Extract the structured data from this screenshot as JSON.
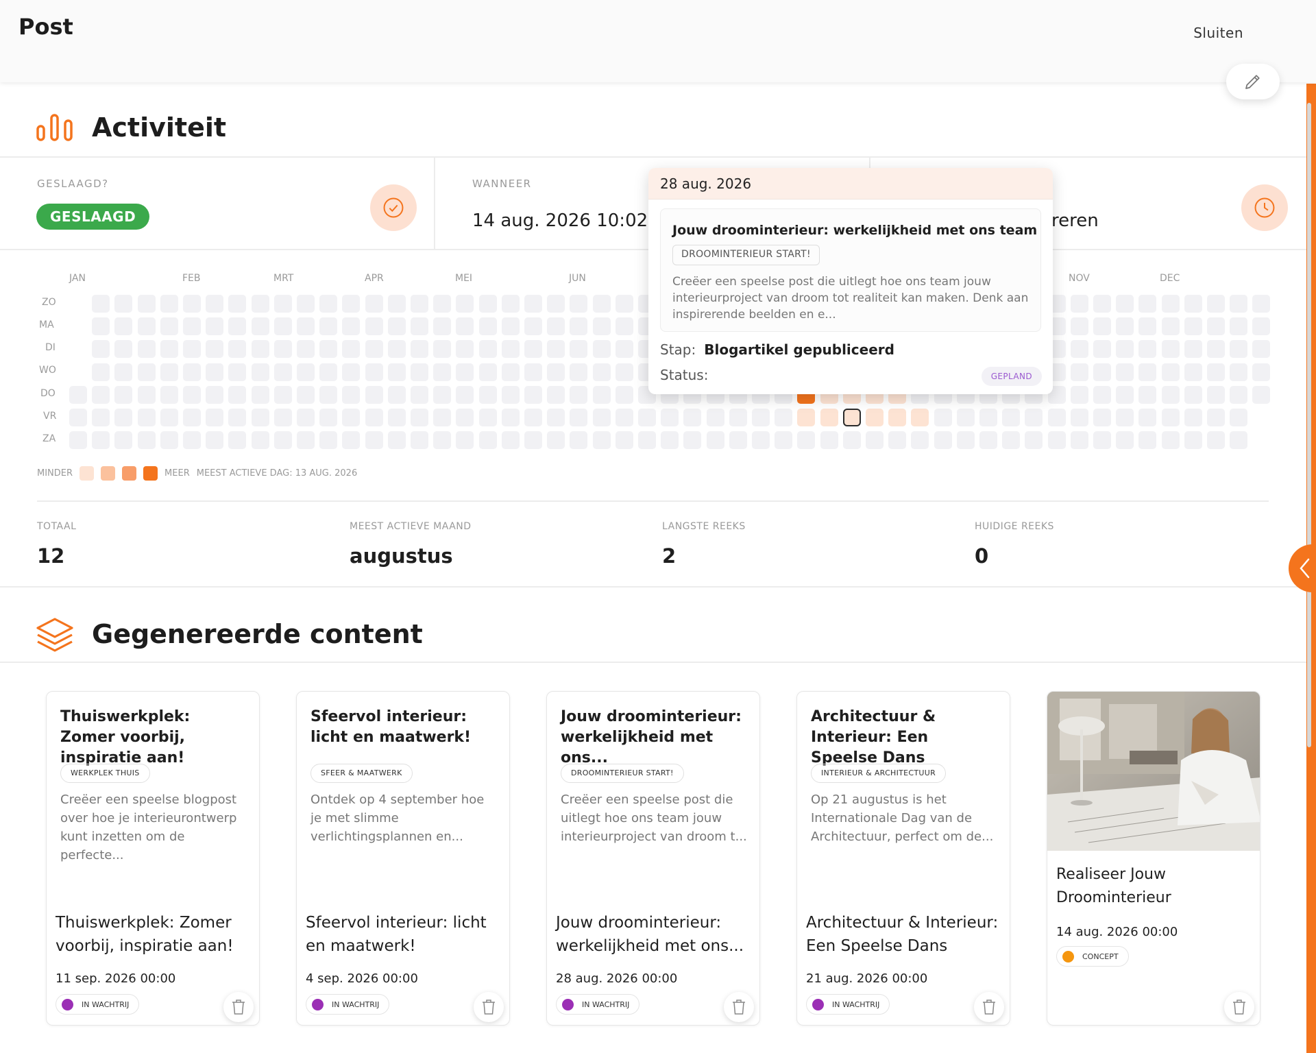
{
  "header": {
    "title": "Post",
    "close_label": "Sluiten"
  },
  "activity": {
    "heading": "Activiteit",
    "geslaagd": {
      "label": "GESLAAGD?",
      "badge": "GESLAAGD"
    },
    "wanneer": {
      "label": "WANNEER",
      "value": "14 aug. 2026 10:02"
    },
    "third_cell_value_partial": "ereren",
    "months": [
      "JAN",
      "FEB",
      "MRT",
      "APR",
      "MEI",
      "JUN",
      "NOV",
      "DEC"
    ],
    "days": [
      "ZO",
      "MA",
      "DI",
      "WO",
      "DO",
      "VR",
      "ZA"
    ],
    "legend": {
      "less": "MINDER",
      "more": "MEER",
      "most_active": "MEEST ACTIEVE DAG: 13 AUG. 2026"
    },
    "legend_colors": [
      "#fde3d3",
      "#fbc19d",
      "#f89d69",
      "#f4741d"
    ],
    "kpis": [
      {
        "label": "TOTAAL",
        "value": "12"
      },
      {
        "label": "MEEST ACTIEVE MAAND",
        "value": "augustus"
      },
      {
        "label": "LANGSTE REEKS",
        "value": "2"
      },
      {
        "label": "HUIDIGE REEKS",
        "value": "0"
      }
    ]
  },
  "tooltip": {
    "date": "28 aug. 2026",
    "title": "Jouw droominterieur: werkelijkheid met ons team",
    "tag": "DROOMINTERIEUR START!",
    "description": "Creëer een speelse post die uitlegt hoe ons team jouw interieurproject van droom tot realiteit kan maken. Denk aan inspirerende beelden en e...",
    "stap_label": "Stap:",
    "stap_value": "Blogartikel gepubliceerd",
    "status_label": "Status:",
    "status_value": "GEPLAND"
  },
  "content": {
    "heading": "Gegenereerde content",
    "cards": [
      {
        "title": "Thuiswerkplek: Zomer voorbij, inspiratie aan!",
        "tag": "WERKPLEK THUIS",
        "description": "Creëer een speelse blogpost over hoe je interieurontwerp kunt inzetten om de perfecte...",
        "footer_title": "Thuiswerkplek: Zomer voorbij, inspiratie aan!",
        "date": "11 sep. 2026 00:00",
        "status": "IN WACHTRIJ",
        "status_color": "#9b2fb5"
      },
      {
        "title": "Sfeervol interieur: licht en maatwerk!",
        "tag": "SFEER & MAATWERK",
        "description": "Ontdek op 4 september hoe je met slimme verlichtingsplannen en...",
        "footer_title": "Sfeervol interieur: licht en maatwerk!",
        "date": "4 sep. 2026 00:00",
        "status": "IN WACHTRIJ",
        "status_color": "#9b2fb5"
      },
      {
        "title": "Jouw droominterieur: werkelijkheid met ons...",
        "tag": "DROOMINTERIEUR START!",
        "description": "Creëer een speelse post die uitlegt hoe ons team jouw interieurproject van droom t...",
        "footer_title": "Jouw droominterieur: werkelijkheid met ons...",
        "date": "28 aug. 2026 00:00",
        "status": "IN WACHTRIJ",
        "status_color": "#9b2fb5"
      },
      {
        "title": "Architectuur & Interieur: Een Speelse Dans",
        "tag": "INTERIEUR & ARCHITECTUUR",
        "description": "Op 21 augustus is het Internationale Dag van de Architectuur, perfect om de...",
        "footer_title": "Architectuur & Interieur: Een Speelse Dans",
        "date": "21 aug. 2026 00:00",
        "status": "IN WACHTRIJ",
        "status_color": "#9b2fb5"
      },
      {
        "footer_title": "Realiseer Jouw Droominterieur",
        "date": "14 aug. 2026 00:00",
        "status": "CONCEPT",
        "status_color": "#f5960f"
      }
    ]
  }
}
